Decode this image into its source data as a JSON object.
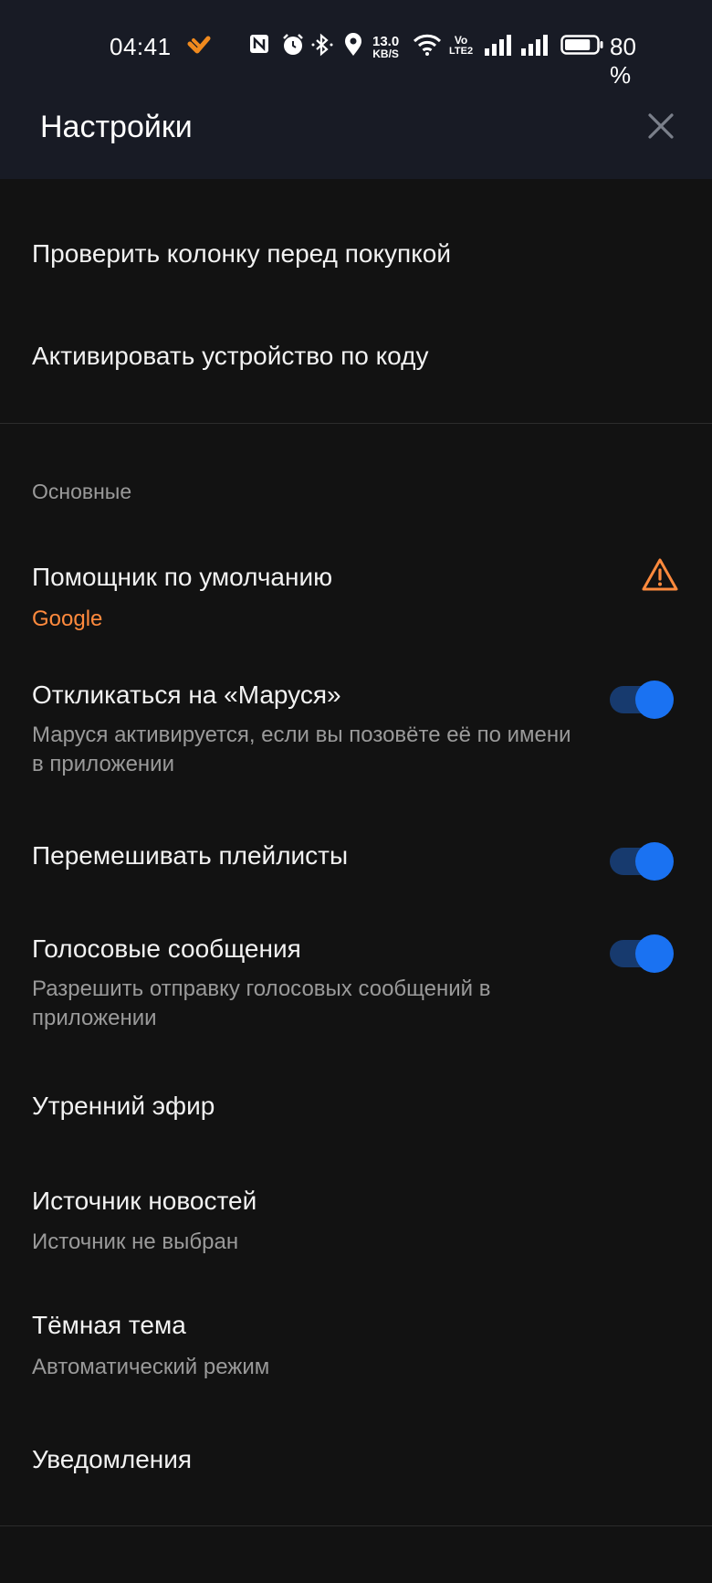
{
  "status_bar": {
    "time": "04:41",
    "speed_value": "13.0",
    "speed_unit": "KB/S",
    "network_label_top": "Vo",
    "network_label_bottom": "LTE2",
    "battery_percent": "80 %",
    "battery_level": 0.8,
    "icons": [
      "app-logo-icon",
      "nfc-icon",
      "alarm-icon",
      "bluetooth-icon",
      "location-icon",
      "wifi-icon",
      "signal-icon",
      "signal-icon-2",
      "battery-icon"
    ]
  },
  "header": {
    "title": "Настройки",
    "close_icon": "close-icon"
  },
  "top_items": [
    {
      "title": "Проверить колонку перед покупкой"
    },
    {
      "title": "Активировать устройство по коду"
    }
  ],
  "section": {
    "label": "Основные",
    "items": {
      "assistant": {
        "title": "Помощник по умолчанию",
        "value": "Google",
        "icon": "warning-icon"
      },
      "marusya": {
        "title": "Откликаться на «Маруся»",
        "subtitle": "Маруся активируется, если вы позовёте её по имени в приложении",
        "enabled": true
      },
      "shuffle": {
        "title": "Перемешивать плейлисты",
        "enabled": true
      },
      "voice": {
        "title": "Голосовые сообщения",
        "subtitle": "Разрешить отправку голосовых сообщений в приложении",
        "enabled": true
      },
      "morning": {
        "title": "Утренний эфир"
      },
      "news": {
        "title": "Источник новостей",
        "subtitle": "Источник не выбран"
      },
      "theme": {
        "title": "Тёмная тема",
        "subtitle": "Автоматический режим"
      },
      "notifications": {
        "title": "Уведомления"
      }
    }
  },
  "colors": {
    "background": "#121212",
    "header": "#181b25",
    "accent": "#ff8a3d",
    "toggle_on": "#1a72f2",
    "secondary_text": "#9a9a9a"
  }
}
